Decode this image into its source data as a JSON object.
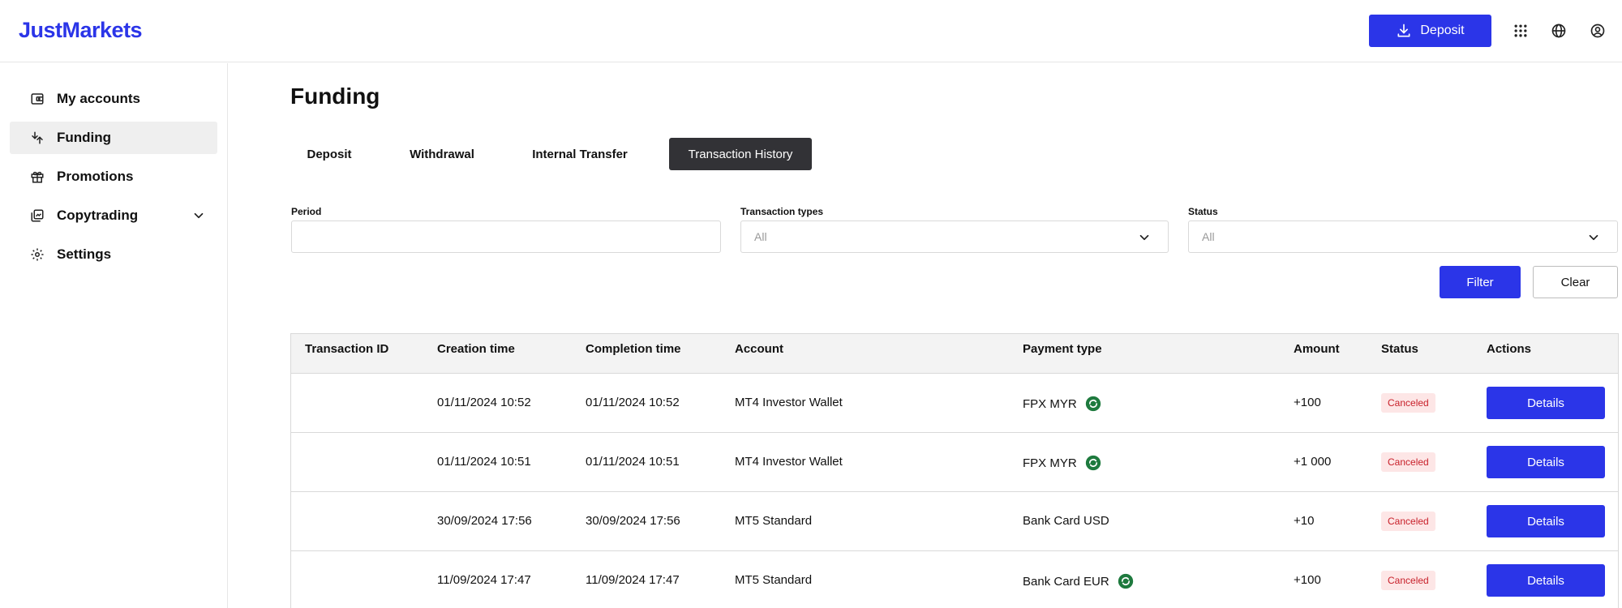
{
  "app": {
    "logo": "JustMarkets"
  },
  "header": {
    "deposit_label": "Deposit"
  },
  "sidebar": {
    "items": [
      {
        "label": "My accounts",
        "icon": "wallet-icon"
      },
      {
        "label": "Funding",
        "icon": "transfer-icon",
        "active": true
      },
      {
        "label": "Promotions",
        "icon": "gift-icon"
      },
      {
        "label": "Copytrading",
        "icon": "copy-icon",
        "expandable": true
      },
      {
        "label": "Settings",
        "icon": "gear-icon"
      }
    ]
  },
  "main": {
    "title": "Funding",
    "tabs": [
      {
        "label": "Deposit"
      },
      {
        "label": "Withdrawal"
      },
      {
        "label": "Internal Transfer"
      },
      {
        "label": "Transaction History",
        "active": true
      }
    ],
    "filters": {
      "period": {
        "label": "Period",
        "value": ""
      },
      "transaction_types": {
        "label": "Transaction types",
        "value": "All"
      },
      "status": {
        "label": "Status",
        "value": "All"
      }
    },
    "filter_button": "Filter",
    "clear_button": "Clear",
    "table": {
      "columns": [
        "Transaction ID",
        "Creation time",
        "Completion time",
        "Account",
        "Payment type",
        "Amount",
        "Status",
        "Actions"
      ],
      "rows": [
        {
          "id": "",
          "created": "01/11/2024 10:52",
          "completed": "01/11/2024 10:52",
          "account": "MT4 Investor Wallet",
          "payment": "FPX MYR",
          "payment_icon": true,
          "amount": "+100",
          "status": "Canceled",
          "action": "Details"
        },
        {
          "id": "",
          "created": "01/11/2024 10:51",
          "completed": "01/11/2024 10:51",
          "account": "MT4 Investor Wallet",
          "payment": "FPX MYR",
          "payment_icon": true,
          "amount": "+1 000",
          "status": "Canceled",
          "action": "Details"
        },
        {
          "id": "",
          "created": "30/09/2024 17:56",
          "completed": "30/09/2024 17:56",
          "account": "MT5 Standard",
          "payment": "Bank Card USD",
          "payment_icon": false,
          "amount": "+10",
          "status": "Canceled",
          "action": "Details"
        },
        {
          "id": "",
          "created": "11/09/2024 17:47",
          "completed": "11/09/2024 17:47",
          "account": "MT5 Standard",
          "payment": "Bank Card EUR",
          "payment_icon": true,
          "amount": "+100",
          "status": "Canceled",
          "action": "Details"
        }
      ]
    }
  },
  "colors": {
    "brand": "#2b35e8",
    "active_tab": "#323236",
    "canceled_bg": "#fde6e6",
    "canceled_text": "#c8202a",
    "payment_icon": "#1e7a3e"
  }
}
